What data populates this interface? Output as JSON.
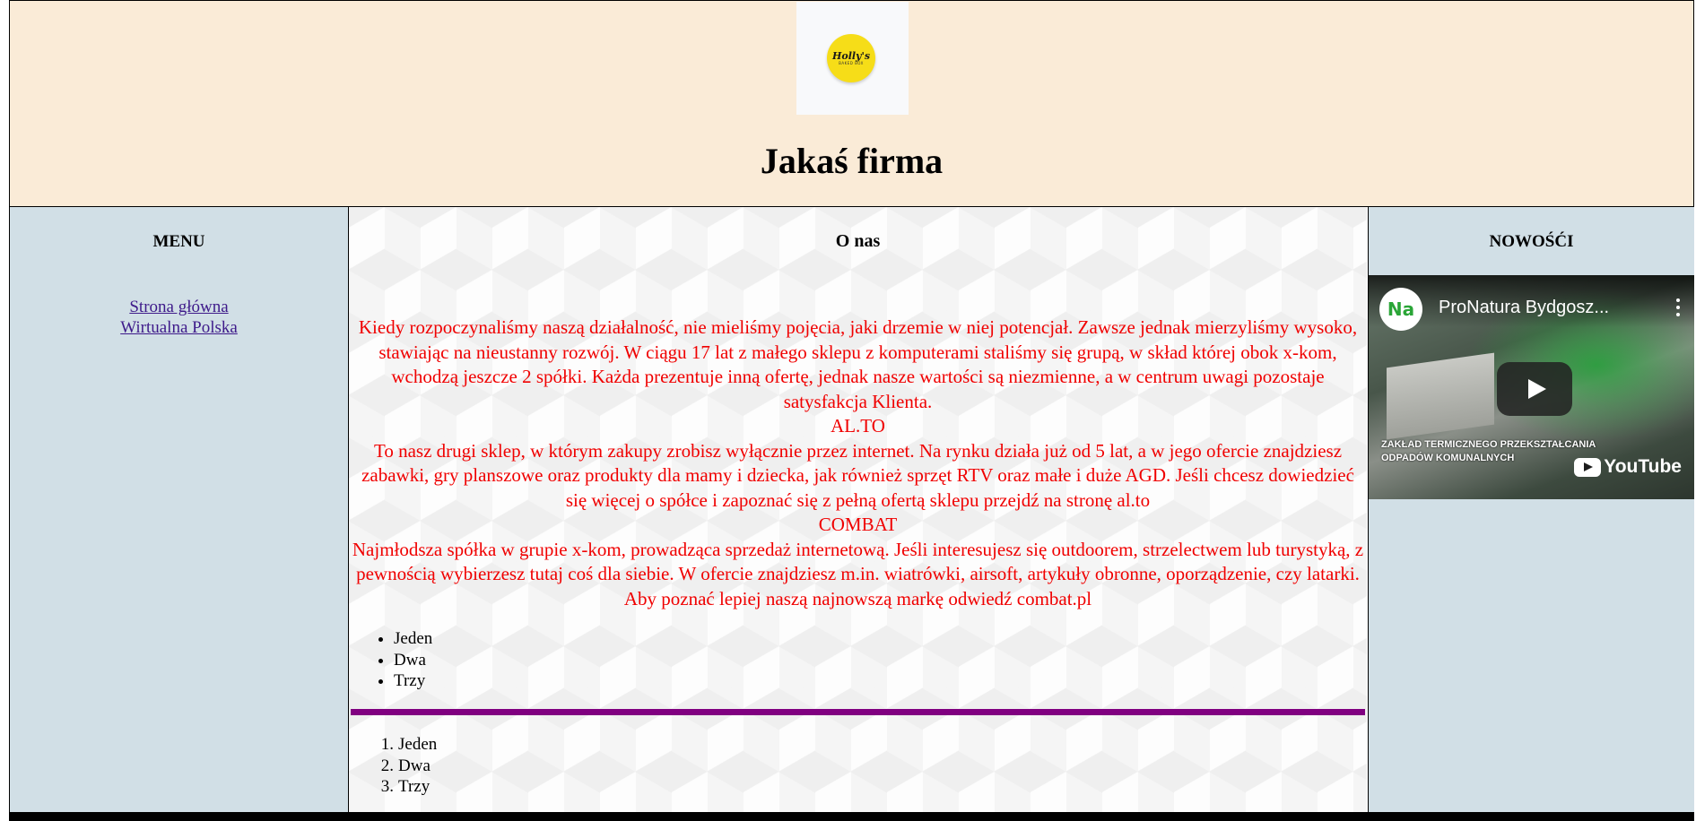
{
  "header": {
    "logo": {
      "name": "Holly's logo",
      "text": "Holly's",
      "subtext": "BAKED BOX",
      "color": "#f6dd18"
    },
    "title": "Jakaś firma"
  },
  "left": {
    "heading": "MENU",
    "links": [
      {
        "label": "Strona główna"
      },
      {
        "label": "Wirtualna Polska"
      }
    ]
  },
  "main": {
    "heading": "O nas",
    "paragraphs": [
      "Kiedy rozpoczynaliśmy naszą działalność, nie mieliśmy pojęcia, jaki drzemie w niej potencjał. Zawsze jednak mierzyliśmy wysoko, stawiając na nieustanny rozwój. W ciągu 17 lat z małego sklepu z komputerami staliśmy się grupą, w skład której obok x-kom, wchodzą jeszcze 2 spółki. Każda prezentuje inną ofertę, jednak nasze wartości są niezmienne, a w centrum uwagi pozostaje satysfakcja Klienta.",
      "AL.TO",
      "To nasz drugi sklep, w którym zakupy zrobisz wyłącznie przez internet. Na rynku działa już od 5 lat, a w jego ofercie znajdziesz zabawki, gry planszowe oraz produkty dla mamy i dziecka, jak również sprzęt RTV oraz małe i duże AGD. Jeśli chcesz dowiedzieć się więcej o spółce i zapoznać się z pełną ofertą sklepu przejdź na stronę al.to",
      "COMBAT",
      "Najmłodsza spółka w grupie x-kom, prowadząca sprzedaż internetową. Jeśli interesujesz się outdoorem, strzelectwem lub turystyką, z pewnością wybierzesz tutaj coś dla siebie. W ofercie znajdziesz m.in. wiatrówki, airsoft, artykuły obronne, oporządzenie, czy latarki. Aby poznać lepiej naszą najnowszą markę odwiedź combat.pl"
    ],
    "text_color": "#f00000",
    "unordered_list": [
      "Jeden",
      "Dwa",
      "Trzy"
    ],
    "divider_color": "#800080",
    "ordered_list": [
      {
        "num": "1.",
        "text": "Jeden"
      },
      {
        "num": "2.",
        "text": "Dwa"
      },
      {
        "num": "3.",
        "text": "Trzy"
      }
    ]
  },
  "right": {
    "heading": "NOWOŚĆI",
    "video": {
      "channel_icon_text": "Na",
      "title": "ProNatura Bydgosz...",
      "caption_line1": "ZAKŁAD TERMICZNEGO PRZEKSZTAŁCANIA",
      "caption_line2": "ODPADÓW KOMUNALNYCH",
      "platform": "YouTube"
    }
  },
  "colors": {
    "header_bg": "#faebd7",
    "sidebar_bg": "#d1dfe6",
    "link": "#3e1a8a"
  }
}
